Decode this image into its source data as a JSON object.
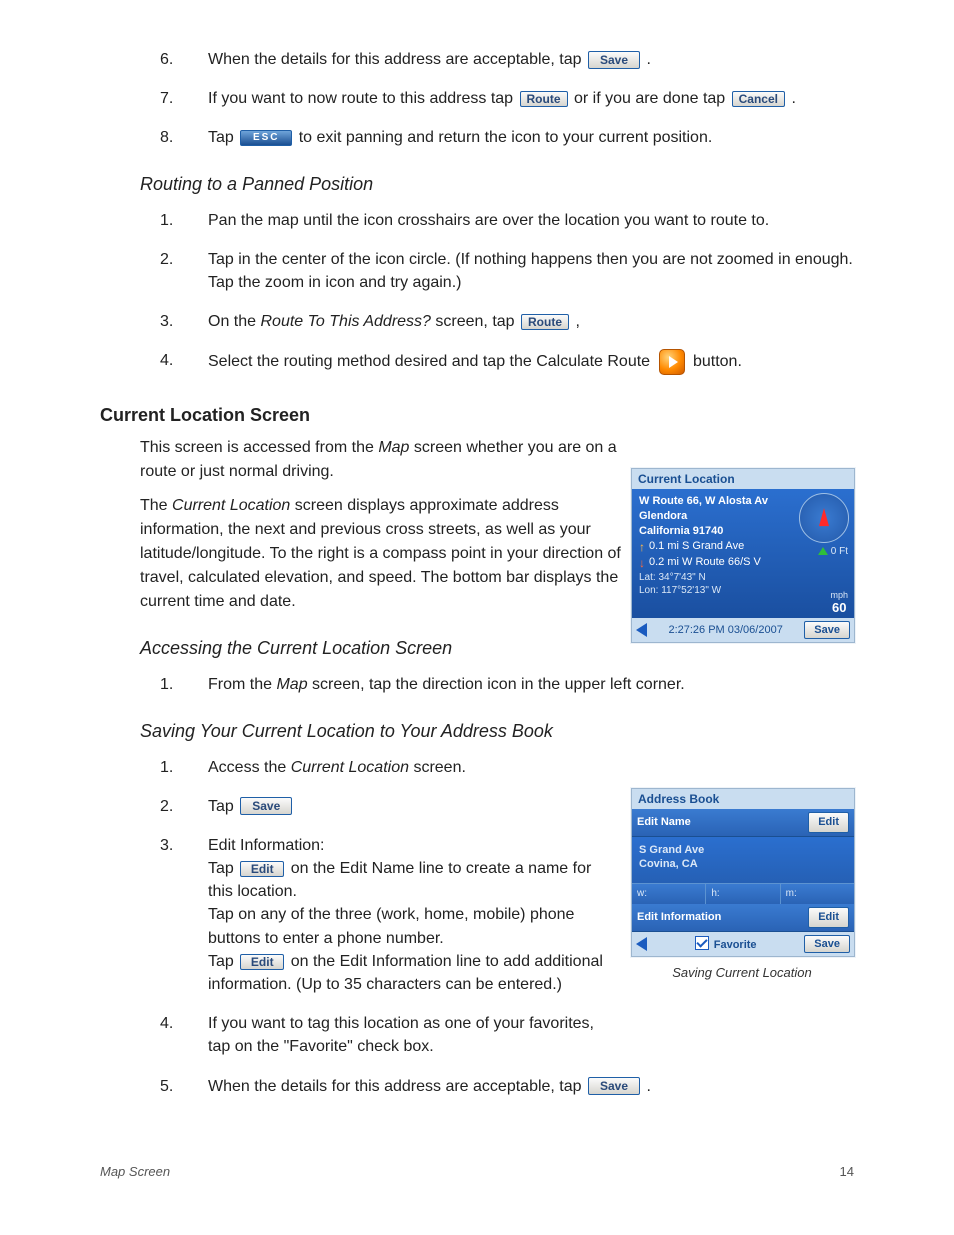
{
  "top_steps": [
    {
      "n": "6.",
      "text_before": "When the details for this address are acceptable, tap ",
      "btn1": "Save",
      "text_after": " ."
    },
    {
      "n": "7.",
      "text_before": "If you want to now route to this address tap ",
      "btn1": "Route",
      "text_mid": " or if you are done tap ",
      "btn2": "Cancel",
      "text_after": " ."
    },
    {
      "n": "8.",
      "text_before": "Tap ",
      "btn_esc": "ESC",
      "text_after": " to exit panning and return the icon to your current position."
    }
  ],
  "headings": {
    "h1": "Routing to a Panned Position",
    "h2": "Current Location Screen",
    "h3": "Accessing the Current Location Screen",
    "h4": "Saving Your Current Location to Your Address Book"
  },
  "pan_steps": [
    {
      "n": "1.",
      "text": "Pan the map until the icon crosshairs are over the location you want to route to."
    },
    {
      "n": "2.",
      "text": "Tap in the center of the icon circle.  (If nothing happens then you are not zoomed in enough.  Tap the zoom in icon and try again.)"
    },
    {
      "n": "3.",
      "text_before": "On the ",
      "ital": "Route To This Address?",
      "text_mid": " screen, tap ",
      "btn1": "Route",
      "text_after": " ,"
    },
    {
      "n": "4.",
      "text_before": "Select the routing method desired and tap the Calculate Route ",
      "icon": "play",
      "text_after": " button."
    }
  ],
  "curloc_para1_a": "This screen is accessed from the ",
  "curloc_para1_i": "Map",
  "curloc_para1_b": " screen whether you are on a route or just normal driving.",
  "curloc_para2_a": "The ",
  "curloc_para2_i": "Current Location",
  "curloc_para2_b": " screen displays approximate address information, the next and previous cross streets, as well as your latitude/longitude.  To the right is a compass point in your direction of travel, calculated elevation, and speed.  The bottom bar displays the current time and date.",
  "access_step": {
    "n": "1.",
    "a": "From the ",
    "i": "Map",
    "b": " screen, tap the direction icon in the upper left corner."
  },
  "save_steps": {
    "s1": {
      "n": "1.",
      "a": "Access the ",
      "i": "Current Location",
      "b": " screen."
    },
    "s2": {
      "n": "2.",
      "a": "Tap ",
      "btn": "Save"
    },
    "s3": {
      "n": "3.",
      "head": "Edit Information:",
      "l1a": "Tap ",
      "l1btn": "Edit",
      "l1b": " on the Edit Name line to create a name for this location.",
      "l2": "Tap on any of the three (work, home, mobile) phone buttons to enter a phone number.",
      "l3a": "Tap ",
      "l3btn": "Edit",
      "l3b": " on the Edit Information line to add additional information.  (Up to 35 characters can be entered.)"
    },
    "s4": {
      "n": "4.",
      "t": "If you want to tag this location as one of your favorites, tap on the \"Favorite\" check box."
    },
    "s5": {
      "n": "5.",
      "a": "When the details for this address are acceptable, tap ",
      "btn": "Save",
      "b": " ."
    }
  },
  "screen1": {
    "title": "Current Location",
    "addr1": "W Route 66, W Alosta Av",
    "addr2": "Glendora",
    "addr3": "California 91740",
    "crossUp": "0.1 mi S Grand Ave",
    "crossDn": "0.2 mi W Route 66/S V",
    "lat": "Lat:  34°7'43\"   N",
    "lon": "Lon: 117°52'13\"   W",
    "elev": "0 Ft",
    "mph": "60",
    "mph_lbl": "mph",
    "time": "2:27:26 PM  03/06/2007",
    "save": "Save"
  },
  "screen2": {
    "title": "Address Book",
    "editname": "Edit Name",
    "edit": "Edit",
    "addr1": "S Grand Ave",
    "addr2": "Covina, CA",
    "w": "w:",
    "h": "h:",
    "m": "m:",
    "editinfo": "Edit Information",
    "fav": "Favorite",
    "save": "Save",
    "caption": "Saving Current Location"
  },
  "footer": {
    "left": "Map Screen",
    "right": "14"
  }
}
